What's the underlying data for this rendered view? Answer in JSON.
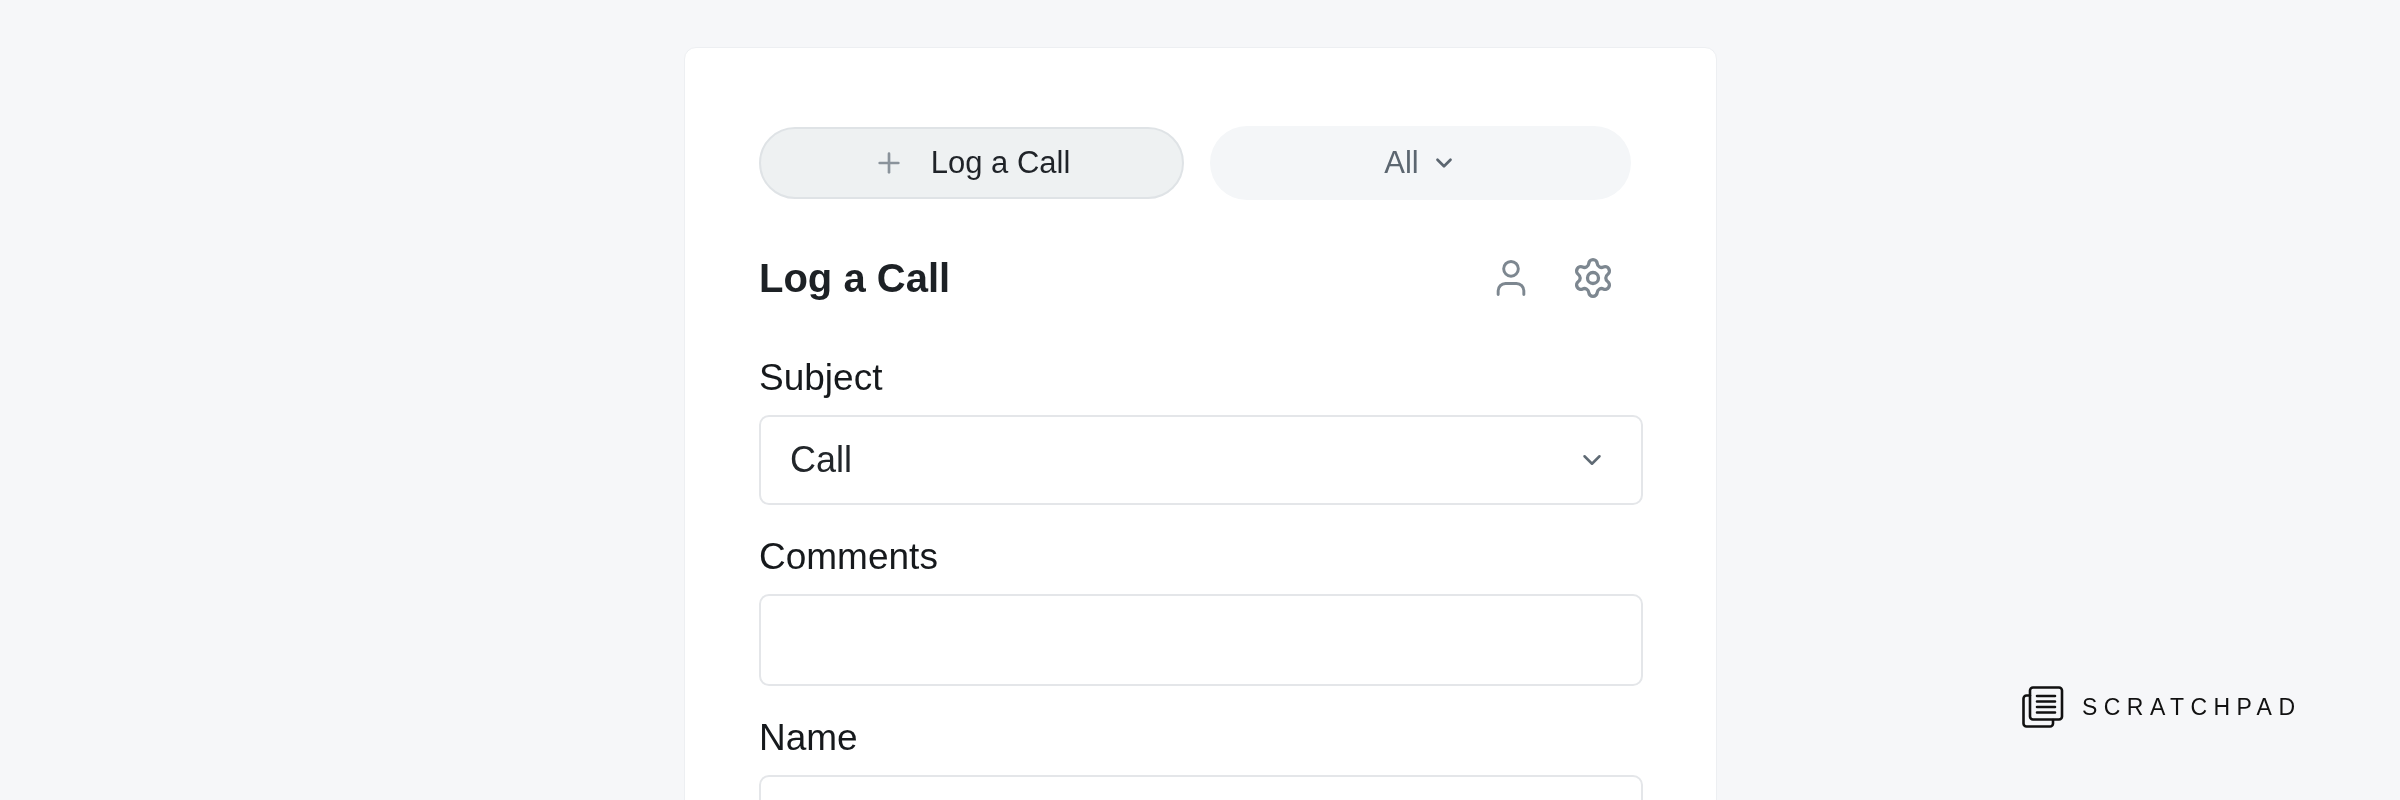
{
  "toolbar": {
    "log_button": {
      "label": "Log a Call"
    },
    "filter_dropdown": {
      "value": "All"
    }
  },
  "panel": {
    "title": "Log a Call"
  },
  "form": {
    "fields": [
      {
        "label": "Subject",
        "kind": "select",
        "value": "Call"
      },
      {
        "label": "Comments",
        "kind": "text"
      },
      {
        "label": "Name",
        "kind": "text"
      }
    ]
  },
  "brand": {
    "name": "SCRATCHPAD"
  }
}
